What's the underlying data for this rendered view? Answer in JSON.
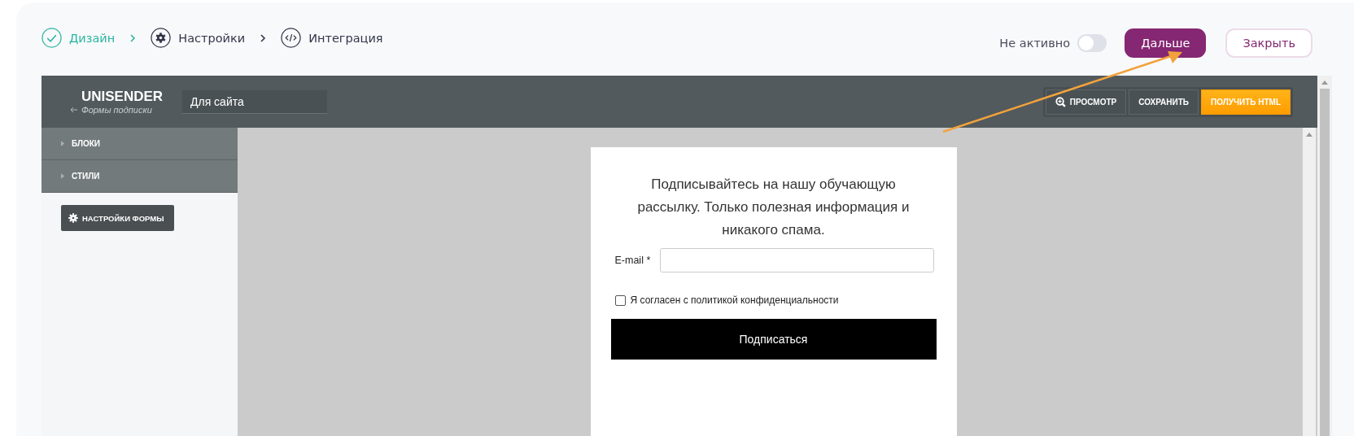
{
  "steps": [
    {
      "label": "Дизайн",
      "kind": "check",
      "completed": true
    },
    {
      "label": "Настройки",
      "kind": "gear",
      "completed": false
    },
    {
      "label": "Интеграция",
      "kind": "code",
      "completed": false
    }
  ],
  "status_toggle": {
    "label": "Не активно",
    "on": false
  },
  "buttons": [
    {
      "label": "Дальше",
      "kind": "primary"
    },
    {
      "label": "Закрыть",
      "kind": "outline"
    }
  ],
  "editor": {
    "logo": "UNISENDER",
    "back_link": "Формы подписки",
    "name_field": "Для сайта",
    "toolbar": [
      {
        "label": "ПРОСМОТР",
        "kind": "preview"
      },
      {
        "label": "СОХРАНИТЬ",
        "kind": "plain"
      },
      {
        "label": "ПОЛУЧИТЬ HTML",
        "kind": "accent"
      }
    ],
    "sidebar": {
      "sections": [
        {
          "label": "БЛОКИ",
          "expanded": false
        },
        {
          "label": "СТИЛИ",
          "expanded": false
        }
      ],
      "settings_button": "НАСТРОЙКИ ФОРМЫ"
    },
    "form": {
      "title": "Подписывайтесь на нашу обучающую рассылку. Только полезная информация и никакого спама.",
      "email_label": "E-mail",
      "required_mark": "*",
      "consent": {
        "label": "Я согласен с политикой конфиденциальности",
        "checked": false
      },
      "submit": "Подписаться"
    }
  }
}
